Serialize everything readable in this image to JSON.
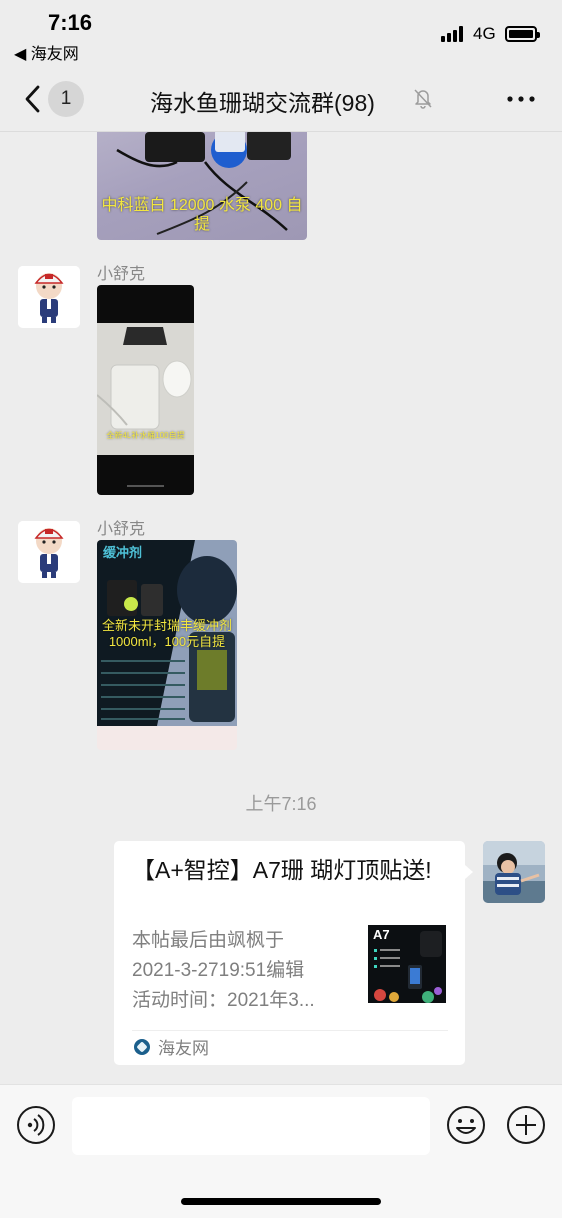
{
  "status_bar": {
    "time": "7:16",
    "back_app": "◀ 海友网",
    "network": "4G"
  },
  "nav": {
    "unread_count": "1",
    "title": "海水鱼珊瑚交流群(98)"
  },
  "messages": [
    {
      "type": "image",
      "caption": "中科蓝白 12000 水泵 400 自提"
    },
    {
      "type": "image",
      "sender": "小舒克",
      "caption": "全新4L补水桶100自提"
    },
    {
      "type": "image",
      "sender": "小舒克",
      "image_heading": "缓冲剂",
      "caption": "全新未开封瑞丰缓冲剂1000ml，100元自提"
    }
  ],
  "timestamp": "上午7:16",
  "link_card": {
    "title": "【A+智控】A7珊 瑚灯顶贴送!",
    "description_lines": [
      "本帖最后由飒枫于",
      "2021-3-2719:51编辑",
      "活动时间：2021年3..."
    ],
    "thumb_label": "A7",
    "source": "海友网"
  },
  "input_bar": {
    "placeholder": ""
  },
  "colors": {
    "chat_background": "#ededed",
    "caption_yellow": "#f2e640",
    "card_background": "#ffffff"
  },
  "icons": [
    "back-chevron-icon",
    "mute-bell-icon",
    "more-icon",
    "voice-icon",
    "emoji-icon",
    "plus-icon"
  ]
}
